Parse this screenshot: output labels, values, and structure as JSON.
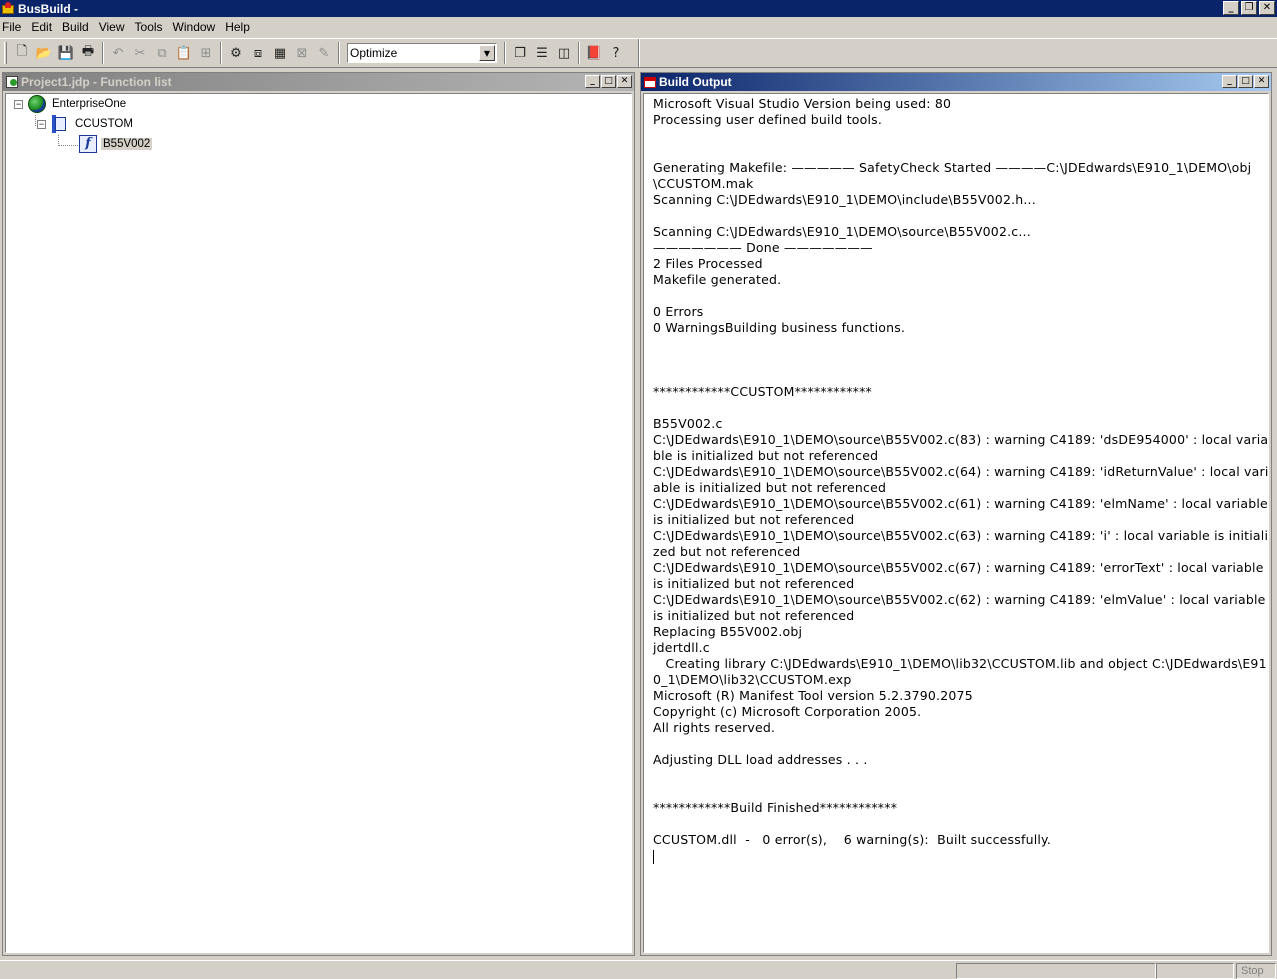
{
  "window": {
    "title": "BusBuild -"
  },
  "menu": [
    "File",
    "Edit",
    "Build",
    "View",
    "Tools",
    "Window",
    "Help"
  ],
  "toolbar": {
    "groups": [
      [
        {
          "icon": "new-file-icon",
          "glyph": "🗋",
          "enabled": true
        },
        {
          "icon": "open-folder-icon",
          "glyph": "📂",
          "enabled": true
        },
        {
          "icon": "save-icon",
          "glyph": "💾",
          "enabled": true
        },
        {
          "icon": "print-icon",
          "glyph": "🖶",
          "enabled": true
        }
      ],
      [
        {
          "icon": "undo-icon",
          "glyph": "↶",
          "enabled": false
        },
        {
          "icon": "cut-icon",
          "glyph": "✂",
          "enabled": false
        },
        {
          "icon": "copy-icon",
          "glyph": "⧉",
          "enabled": false
        },
        {
          "icon": "paste-icon",
          "glyph": "📋",
          "enabled": true
        },
        {
          "icon": "find-icon",
          "glyph": "⊞",
          "enabled": false
        }
      ],
      [
        {
          "icon": "build-icon",
          "glyph": "⚙",
          "enabled": true
        },
        {
          "icon": "compile-icon",
          "glyph": "⧈",
          "enabled": true
        },
        {
          "icon": "build-all-icon",
          "glyph": "▦",
          "enabled": true
        },
        {
          "icon": "rebuild-icon",
          "glyph": "⊠",
          "enabled": false
        },
        {
          "icon": "stop-build-icon",
          "glyph": "✎",
          "enabled": false
        }
      ]
    ],
    "config_combo": {
      "selected": "Optimize"
    },
    "groups_after": [
      [
        {
          "icon": "cascade-icon",
          "glyph": "❐",
          "enabled": true
        },
        {
          "icon": "tile-horizontal-icon",
          "glyph": "☰",
          "enabled": true
        },
        {
          "icon": "tile-vertical-icon",
          "glyph": "◫",
          "enabled": true
        }
      ],
      [
        {
          "icon": "book-icon",
          "glyph": "📕",
          "enabled": true
        },
        {
          "icon": "help-icon",
          "glyph": "?",
          "enabled": true
        }
      ]
    ]
  },
  "function_list": {
    "title": "Project1.jdp - Function list",
    "tree": {
      "root": {
        "label": "EnterpriseOne",
        "expander": "−"
      },
      "child": {
        "label": "CCUSTOM",
        "expander": "−"
      },
      "leaf": {
        "label": "B55V002"
      }
    }
  },
  "build_output": {
    "title": "Build Output",
    "lines": [
      "Microsoft Visual Studio Version being used: 80",
      "Processing user defined build tools.",
      "",
      "",
      "Generating Makefile: ————— SafetyCheck Started ————C:\\JDEdwards\\E910_1\\DEMO\\obj",
      "\\CCUSTOM.mak",
      "Scanning C:\\JDEdwards\\E910_1\\DEMO\\include\\B55V002.h...",
      "",
      "Scanning C:\\JDEdwards\\E910_1\\DEMO\\source\\B55V002.c...",
      "——————— Done ———————",
      "2 Files Processed",
      "Makefile generated.",
      "",
      "0 Errors",
      "0 WarningsBuilding business functions.",
      "",
      "",
      "",
      "************CCUSTOM************",
      "",
      "B55V002.c",
      "C:\\JDEdwards\\E910_1\\DEMO\\source\\B55V002.c(83) : warning C4189: 'dsDE954000' : local variable is initialized but not referenced",
      "C:\\JDEdwards\\E910_1\\DEMO\\source\\B55V002.c(64) : warning C4189: 'idReturnValue' : local variable is initialized but not referenced",
      "C:\\JDEdwards\\E910_1\\DEMO\\source\\B55V002.c(61) : warning C4189: 'elmName' : local variable is initialized but not referenced",
      "C:\\JDEdwards\\E910_1\\DEMO\\source\\B55V002.c(63) : warning C4189: 'i' : local variable is initialized but not referenced",
      "C:\\JDEdwards\\E910_1\\DEMO\\source\\B55V002.c(67) : warning C4189: 'errorText' : local variable is initialized but not referenced",
      "C:\\JDEdwards\\E910_1\\DEMO\\source\\B55V002.c(62) : warning C4189: 'elmValue' : local variable is initialized but not referenced",
      "Replacing B55V002.obj",
      "jdertdll.c",
      "   Creating library C:\\JDEdwards\\E910_1\\DEMO\\lib32\\CCUSTOM.lib and object C:\\JDEdwards\\E910_1\\DEMO\\lib32\\CCUSTOM.exp",
      "Microsoft (R) Manifest Tool version 5.2.3790.2075",
      "Copyright (c) Microsoft Corporation 2005.",
      "All rights reserved.",
      "",
      "Adjusting DLL load addresses . . .",
      "",
      "",
      "************Build Finished************",
      "",
      "CCUSTOM.dll  -   0 error(s),    6 warning(s):  Built successfully."
    ]
  },
  "status_bar": {
    "stop_label": "Stop"
  },
  "colors": {
    "active_caption": "#0a246a",
    "inactive_caption": "#808080",
    "face": "#d4d0c8"
  }
}
